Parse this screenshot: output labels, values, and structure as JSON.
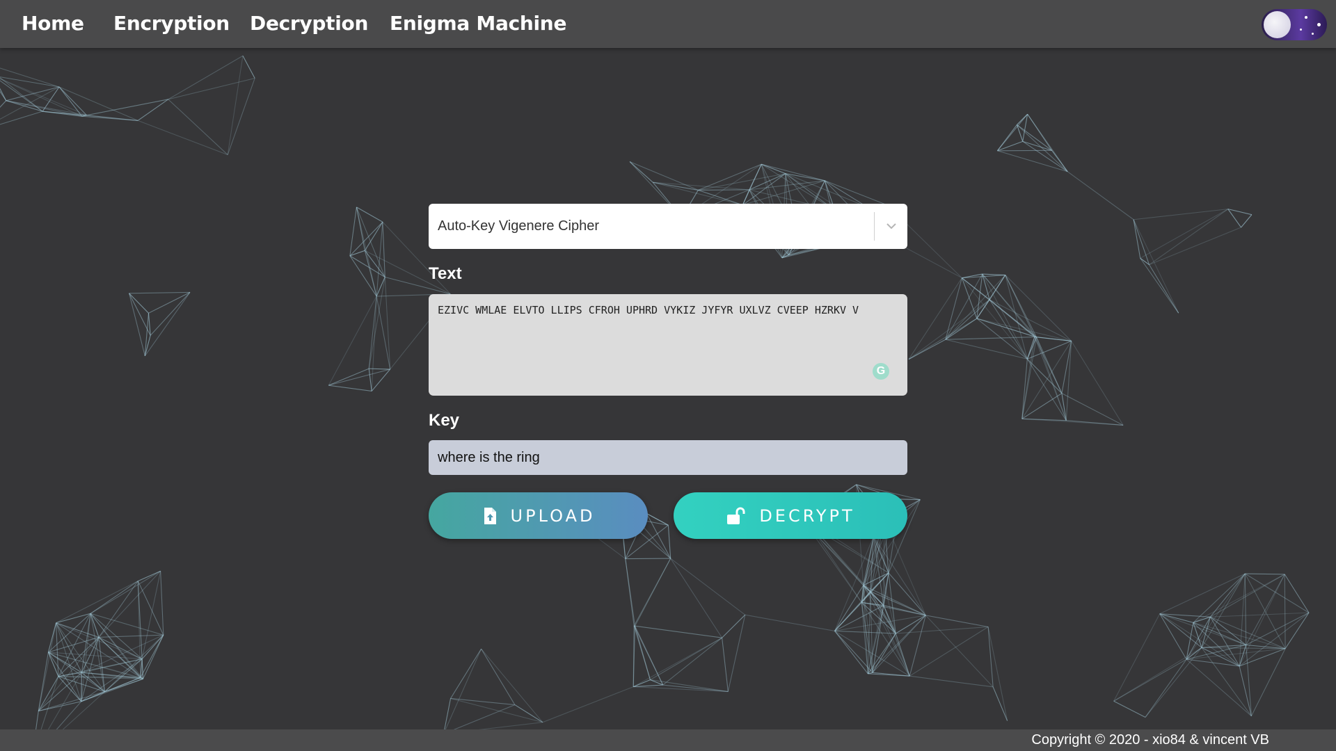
{
  "nav": {
    "links": [
      "Home",
      "Encryption",
      "Decryption",
      "Enigma Machine"
    ]
  },
  "theme_toggle": {
    "icon": "moon-icon",
    "state": "dark"
  },
  "cipher_select": {
    "value": "Auto-Key Vigenere Cipher"
  },
  "text_field": {
    "label": "Text",
    "value": "EZIVC WMLAE ELVTO LLIPS CFROH UPHRD VYKIZ JYFYR UXLVZ CVEEP HZRKV V",
    "extension_icon": "grammarly-icon",
    "extension_letter": "G"
  },
  "key_field": {
    "label": "Key",
    "value": "where is the ring"
  },
  "buttons": {
    "upload": {
      "label": "UPLOAD",
      "icon": "file-upload-icon"
    },
    "decrypt": {
      "label": "DECRYPT",
      "icon": "unlock-icon"
    }
  },
  "footer": {
    "copyright": "Copyright © 2020 - xio84 & vincent VB"
  },
  "colors": {
    "background": "#363638",
    "navbar": "#4a4a4b",
    "network_lines": "#9fc4d2",
    "upload_gradient": [
      "#45a7a0",
      "#5a8dc0"
    ],
    "decrypt_gradient": [
      "#33d1c0",
      "#2bbfb8"
    ]
  }
}
